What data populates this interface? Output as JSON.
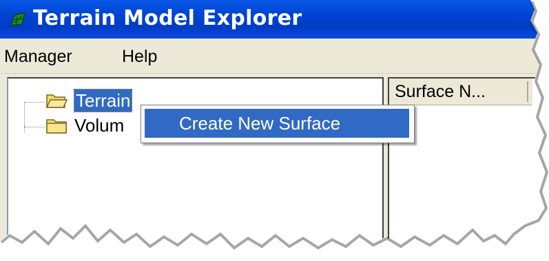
{
  "window": {
    "title": "Terrain Model Explorer",
    "icon": "terrain-icon",
    "colors": {
      "titlebar": "#0045d4",
      "selection": "#316ac5",
      "chrome": "#ece9d8"
    }
  },
  "menubar": {
    "items": [
      "Manager",
      "Help"
    ]
  },
  "tree": {
    "items": [
      {
        "label": "Terrain",
        "icon": "folder-open-icon",
        "selected": true
      },
      {
        "label": "Volum",
        "icon": "folder-icon",
        "selected": false
      }
    ]
  },
  "list": {
    "columns": [
      "Surface N..."
    ]
  },
  "context_menu": {
    "items": [
      {
        "label": "Create New Surface",
        "highlighted": true
      }
    ]
  }
}
